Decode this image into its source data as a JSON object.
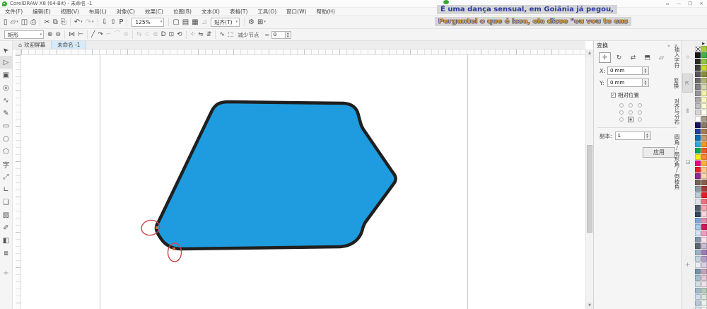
{
  "window": {
    "title": "CorelDRAW X8 (64-Bit) - 未命名 -1",
    "controls": [
      {
        "name": "toolbar-options",
        "glyph": "▫"
      },
      {
        "name": "minimize",
        "glyph": "—"
      },
      {
        "name": "restore",
        "glyph": "❐"
      },
      {
        "name": "close",
        "glyph": "✕"
      }
    ]
  },
  "subtitle_overlay": {
    "line1": "É uma dança sensual, em Goiânia já pegou,",
    "line2": "Perguntei o que é isso, ela disse \"eu vou te ens",
    "line1_color": "#2b3a9e",
    "line2_color": "#dca23e",
    "dot_color": "#36a933"
  },
  "menu_bar": {
    "items": [
      {
        "id": "file",
        "label": "文件(F)"
      },
      {
        "id": "edit",
        "label": "编辑(E)"
      },
      {
        "id": "view",
        "label": "视图(V)"
      },
      {
        "id": "layout",
        "label": "布局(L)"
      },
      {
        "id": "object",
        "label": "对象(C)"
      },
      {
        "id": "effects",
        "label": "效果(C)"
      },
      {
        "id": "bitmaps",
        "label": "位图(B)"
      },
      {
        "id": "text",
        "label": "文本(X)"
      },
      {
        "id": "table",
        "label": "表格(T)"
      },
      {
        "id": "tools",
        "label": "工具(O)"
      },
      {
        "id": "window",
        "label": "窗口(W)"
      },
      {
        "id": "help",
        "label": "帮助(H)"
      }
    ]
  },
  "standard_toolbar": {
    "zoom_level": "125%",
    "items": [
      {
        "name": "new-document",
        "glyph": "▯"
      },
      {
        "name": "open",
        "glyph": "▱",
        "caret": true
      },
      {
        "name": "save",
        "glyph": "◫"
      },
      {
        "name": "print",
        "glyph": "⎙"
      },
      {
        "sep": true
      },
      {
        "name": "cut",
        "glyph": "✂"
      },
      {
        "name": "copy",
        "glyph": "⧉"
      },
      {
        "name": "paste",
        "glyph": "⎘"
      },
      {
        "sep": true
      },
      {
        "name": "undo",
        "glyph": "↶",
        "caret": true
      },
      {
        "name": "redo",
        "glyph": "↷",
        "caret": true,
        "disabled": true
      },
      {
        "sep": true
      },
      {
        "name": "import",
        "glyph": "⇩"
      },
      {
        "name": "export",
        "glyph": "⇧"
      },
      {
        "name": "publish-pdf",
        "glyph": "P"
      },
      {
        "sep": true
      },
      {
        "type": "zoom-combo"
      },
      {
        "sep": true
      },
      {
        "name": "fullscreen-preview",
        "glyph": "▢"
      },
      {
        "name": "show-rulers",
        "glyph": "▤"
      },
      {
        "name": "show-grid",
        "glyph": "▦"
      },
      {
        "name": "snap-toggle",
        "glyph": "⊿",
        "disabled": true
      },
      {
        "type": "snap-combo",
        "label": "贴齐(T)"
      },
      {
        "sep": true
      },
      {
        "name": "options",
        "glyph": "⚙"
      },
      {
        "name": "quick-customize",
        "glyph": "⊞",
        "caret": true
      }
    ]
  },
  "property_bar": {
    "selection_mode": "矩形",
    "reduce_nodes_label": "减少节点",
    "smoothness_icon": "≈",
    "smoothness_value": "0",
    "items": [
      {
        "name": "add-nodes",
        "glyph": "⊕"
      },
      {
        "name": "delete-nodes",
        "glyph": "⊖"
      },
      {
        "sep": true
      },
      {
        "name": "join-two-nodes",
        "glyph": "⋈"
      },
      {
        "name": "break-curve",
        "glyph": "⊢"
      },
      {
        "sep": true
      },
      {
        "name": "convert-to-line",
        "glyph": "╱"
      },
      {
        "name": "convert-to-curve",
        "glyph": "↷"
      },
      {
        "name": "cusp-node",
        "glyph": "⌐",
        "disabled": true
      },
      {
        "name": "smooth-node",
        "glyph": "⌒",
        "disabled": true
      },
      {
        "name": "symmetrical-node",
        "glyph": "≅",
        "disabled": true
      },
      {
        "sep": true
      },
      {
        "name": "reverse-direction",
        "glyph": "⇆",
        "disabled": true
      },
      {
        "name": "extend-curve-to-close",
        "glyph": "⊂",
        "disabled": true
      },
      {
        "name": "extract-subpath",
        "glyph": "⋐",
        "disabled": true
      },
      {
        "name": "close-curve",
        "glyph": "D"
      },
      {
        "name": "stretch-scale-nodes",
        "glyph": "⊡"
      },
      {
        "name": "rotate-skew-nodes",
        "glyph": "⟲"
      },
      {
        "sep": true
      },
      {
        "name": "align-nodes",
        "glyph": "⁘"
      },
      {
        "name": "horizontal-reflect",
        "glyph": "⇋"
      },
      {
        "name": "vertical-reflect",
        "glyph": "⇵"
      },
      {
        "sep": true
      },
      {
        "name": "elastic-mode",
        "glyph": "∿"
      },
      {
        "name": "select-all-nodes",
        "glyph": "⬚"
      }
    ]
  },
  "document_tabs": {
    "welcome_label": "欢迎屏幕",
    "active_label": "未命名 -1"
  },
  "toolbox": {
    "tools": [
      {
        "name": "pick-tool",
        "glyph": "➤",
        "rot": -135
      },
      {
        "name": "shape-tool",
        "glyph": "▷",
        "active": true
      },
      {
        "name": "crop-tool",
        "glyph": "▣"
      },
      {
        "name": "zoom-tool",
        "glyph": "◎"
      },
      {
        "name": "freehand-tool",
        "glyph": "∿"
      },
      {
        "name": "artistic-media-tool",
        "glyph": "✎"
      },
      {
        "name": "rectangle-tool",
        "glyph": "▭"
      },
      {
        "name": "ellipse-tool",
        "glyph": "○"
      },
      {
        "name": "polygon-tool",
        "glyph": "⬠"
      },
      {
        "name": "text-tool",
        "glyph": "字"
      },
      {
        "name": "parallel-dimension-tool",
        "glyph": "⤢"
      },
      {
        "name": "connector-tool",
        "glyph": "∟"
      },
      {
        "name": "drop-shadow-tool",
        "glyph": "❏"
      },
      {
        "name": "transparency-tool",
        "glyph": "▨"
      },
      {
        "name": "color-eyedropper-tool",
        "glyph": "✐"
      },
      {
        "name": "interactive-fill-tool",
        "glyph": "◧"
      },
      {
        "name": "smart-fill-tool",
        "glyph": "⧈"
      }
    ],
    "more_tools_glyph": "+"
  },
  "canvas_shape": {
    "fill_color": "#1e9cdf",
    "outline_color": "#1f1f1f",
    "node_color": "#d96a33"
  },
  "annotations": {
    "circle_color": "#c94b4b"
  },
  "docker": {
    "title": "变换",
    "collapse_glyph": "»",
    "close_glyph": "✕",
    "modes": [
      {
        "name": "position-mode",
        "glyph": "✛",
        "active": true
      },
      {
        "name": "rotate-mode",
        "glyph": "↻"
      },
      {
        "name": "scale-mirror-mode",
        "glyph": "⇄"
      },
      {
        "name": "size-mode",
        "glyph": "⬒"
      },
      {
        "name": "skew-mode",
        "glyph": "▱"
      }
    ],
    "x_label": "X:",
    "x_value": "0 mm",
    "y_label": "Y:",
    "y_value": "0 mm",
    "relative_label": "相对位置",
    "relative_checked": "✓",
    "anchor_selected_index": 7,
    "copies_label": "副本:",
    "copies_value": "1",
    "apply_label": "应用"
  },
  "docker_tabs": [
    {
      "name": "insert-character",
      "icon": "☆",
      "label": "插入字符"
    },
    {
      "name": "transform",
      "icon": "⇱",
      "label": "变换",
      "active": true
    },
    {
      "name": "align-distribute",
      "icon": "⫼",
      "label": "对齐与分布"
    },
    {
      "name": "corner",
      "icon": "◲",
      "label": "圆角/扇形角/倒棱角"
    }
  ],
  "docker_tabs_add_glyph": "+",
  "palette": {
    "flyout_glyph": "▶",
    "left_column": [
      "none",
      "#1a1a1a",
      "#2b2b2b",
      "#404040",
      "#555555",
      "#6b6b6b",
      "#808080",
      "#969696",
      "#ababab",
      "#c0c0c0",
      "#d6d6d6",
      "#ffffff",
      "#1b1464",
      "#21409a",
      "#0071bc",
      "#29abe2",
      "#00a651",
      "#fff200",
      "#ec008c",
      "#ed1c24",
      "#92278f",
      "#736357",
      "#8c9aa5",
      "#bdccd4",
      "#dfe6ea",
      "#4a5b6b",
      "#33475c",
      "#7da7d9",
      "#a9c7e9",
      "#d3e2f4",
      "#8696a7",
      "#5d6770",
      "#9ab4c6",
      "#c3d3de",
      "#e8eef3",
      "#7391a9",
      "#a6bdce",
      "#d1dee8",
      "#a0b9ca",
      "#cfdde8",
      "#b6cad9",
      "#dce7ef"
    ],
    "right_column": [
      "#a6ce39",
      "#39b54a",
      "#8dc63f",
      "#c8d92b",
      "#8a8d3a",
      "#b3b573",
      "#d6d7ad",
      "#f5f1a4",
      "#fbf6bb",
      "#fef9d3",
      "#fffdee",
      "#a79a86",
      "#8c7a66",
      "#a67c52",
      "#c49a6c",
      "#f7941d",
      "#f15a24",
      "#ff8533",
      "#fbb03b",
      "#fdc689",
      "#f9d6ac",
      "#8c5f4a",
      "#a43d35",
      "#ed1c24",
      "#f26d7d",
      "#f8a5b0",
      "#fbd3d9",
      "#e28cae",
      "#d4145a",
      "#f49ac1",
      "#fbdeea",
      "#c8bad2",
      "#9e7bb5",
      "#b49ecb",
      "#dacfe5",
      "#c5a1b9",
      "#e4c8d7",
      "#f0e1ea",
      "#b3cab9",
      "#d5e5d9",
      "#eaf3ed",
      "#f6faf7"
    ]
  }
}
